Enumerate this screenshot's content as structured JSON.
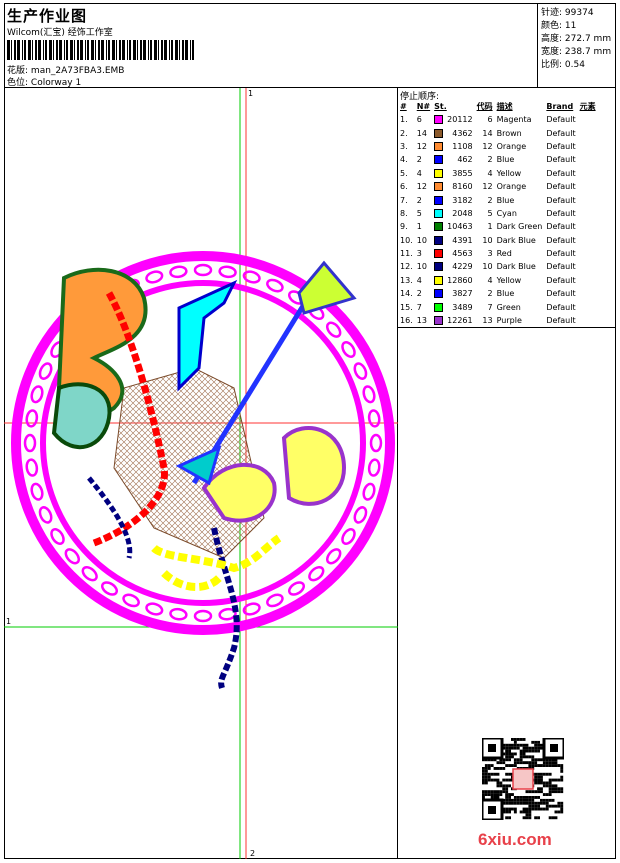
{
  "header": {
    "title": "生产作业图",
    "company": "Wilcom(汇宝) 经饰工作室",
    "design_label": "花版:",
    "design_value": "man_2A73FBA3.EMB",
    "colorway_label": "色位:",
    "colorway_value": "Colorway 1"
  },
  "stats": {
    "stitches_label": "针迹:",
    "stitches_value": "99374",
    "colors_label": "颜色:",
    "colors_value": "11",
    "height_label": "高度:",
    "height_value": "272.7 mm",
    "width_label": "宽度:",
    "width_value": "238.7 mm",
    "scale_label": "比例:",
    "scale_value": "0.54"
  },
  "stop_sequence": {
    "title": "停止顺序:",
    "headers": [
      "#",
      "N#",
      "St.",
      "代码",
      "描述",
      "Brand",
      "元素"
    ],
    "rows": [
      {
        "idx": "1.",
        "n": "6",
        "color": "#ff00ff",
        "st": "20112",
        "code": "6",
        "desc": "Magenta",
        "brand": "Default"
      },
      {
        "idx": "2.",
        "n": "14",
        "color": "#8b5a2b",
        "st": "4362",
        "code": "14",
        "desc": "Brown",
        "brand": "Default"
      },
      {
        "idx": "3.",
        "n": "12",
        "color": "#ff8c32",
        "st": "1108",
        "code": "12",
        "desc": "Orange",
        "brand": "Default"
      },
      {
        "idx": "4.",
        "n": "2",
        "color": "#0000ff",
        "st": "462",
        "code": "2",
        "desc": "Blue",
        "brand": "Default"
      },
      {
        "idx": "5.",
        "n": "4",
        "color": "#ffff00",
        "st": "3855",
        "code": "4",
        "desc": "Yellow",
        "brand": "Default"
      },
      {
        "idx": "6.",
        "n": "12",
        "color": "#ff8c32",
        "st": "8160",
        "code": "12",
        "desc": "Orange",
        "brand": "Default"
      },
      {
        "idx": "7.",
        "n": "2",
        "color": "#0000ff",
        "st": "3182",
        "code": "2",
        "desc": "Blue",
        "brand": "Default"
      },
      {
        "idx": "8.",
        "n": "5",
        "color": "#00ffff",
        "st": "2048",
        "code": "5",
        "desc": "Cyan",
        "brand": "Default"
      },
      {
        "idx": "9.",
        "n": "1",
        "color": "#008000",
        "st": "10463",
        "code": "1",
        "desc": "Dark Green",
        "brand": "Default"
      },
      {
        "idx": "10.",
        "n": "10",
        "color": "#000080",
        "st": "4391",
        "code": "10",
        "desc": "Dark Blue",
        "brand": "Default"
      },
      {
        "idx": "11.",
        "n": "3",
        "color": "#ff0000",
        "st": "4563",
        "code": "3",
        "desc": "Red",
        "brand": "Default"
      },
      {
        "idx": "12.",
        "n": "10",
        "color": "#000080",
        "st": "4229",
        "code": "10",
        "desc": "Dark Blue",
        "brand": "Default"
      },
      {
        "idx": "13.",
        "n": "4",
        "color": "#ffff00",
        "st": "12860",
        "code": "4",
        "desc": "Yellow",
        "brand": "Default"
      },
      {
        "idx": "14.",
        "n": "2",
        "color": "#0000ff",
        "st": "3827",
        "code": "2",
        "desc": "Blue",
        "brand": "Default"
      },
      {
        "idx": "15.",
        "n": "7",
        "color": "#00ff00",
        "st": "3489",
        "code": "7",
        "desc": "Green",
        "brand": "Default"
      },
      {
        "idx": "16.",
        "n": "13",
        "color": "#9933cc",
        "st": "12261",
        "code": "13",
        "desc": "Purple",
        "brand": "Default"
      }
    ]
  },
  "guides": {
    "v1_label": "1",
    "v2_label": "2",
    "h1_label": "1"
  },
  "footer": {
    "logo_text": "6xiu.com"
  }
}
